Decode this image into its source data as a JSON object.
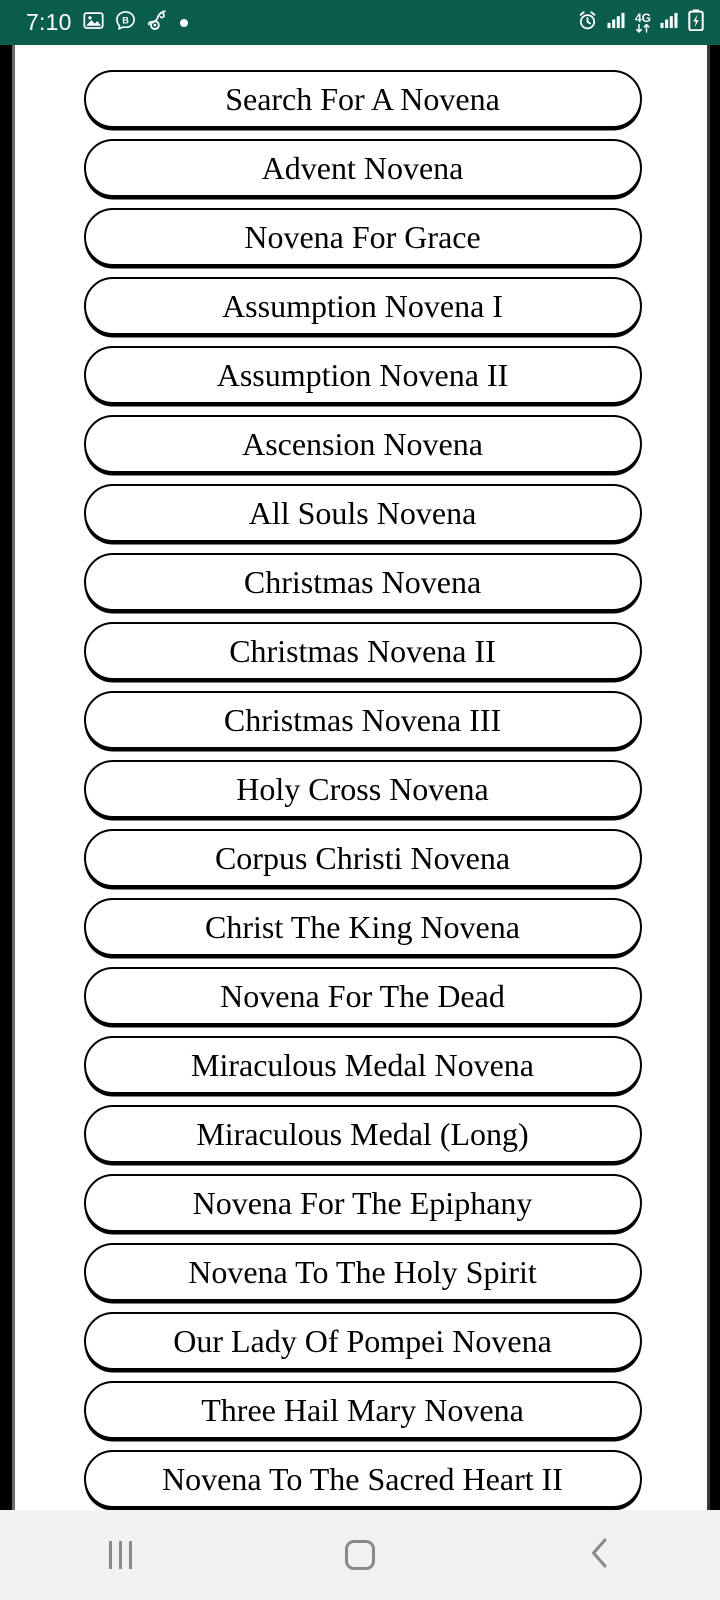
{
  "statusbar": {
    "time": "7:10",
    "network_label": "4G",
    "left_icons": [
      "gallery-icon",
      "messenger-b-icon",
      "uc-browser-squirrel-icon",
      "dot-indicator-icon"
    ],
    "right_icons": [
      "alarm-icon",
      "signal-bars-icon",
      "mobile-data-4g-icon",
      "signal-bars-2-icon",
      "battery-charging-icon"
    ],
    "background_color": "#0a5c4d",
    "foreground_color": "#ffffff"
  },
  "main": {
    "buttons": [
      {
        "label": "Search For A Novena"
      },
      {
        "label": "Advent Novena"
      },
      {
        "label": "Novena For Grace"
      },
      {
        "label": "Assumption Novena I"
      },
      {
        "label": "Assumption Novena II"
      },
      {
        "label": "Ascension Novena"
      },
      {
        "label": "All Souls Novena"
      },
      {
        "label": "Christmas Novena"
      },
      {
        "label": "Christmas Novena II"
      },
      {
        "label": "Christmas Novena III"
      },
      {
        "label": "Holy Cross Novena"
      },
      {
        "label": "Corpus Christi Novena"
      },
      {
        "label": "Christ The King Novena"
      },
      {
        "label": "Novena For The Dead"
      },
      {
        "label": "Miraculous Medal Novena"
      },
      {
        "label": "Miraculous Medal (Long)"
      },
      {
        "label": "Novena For The Epiphany"
      },
      {
        "label": "Novena To The Holy Spirit"
      },
      {
        "label": "Our Lady Of Pompei Novena"
      },
      {
        "label": "Three Hail Mary Novena"
      },
      {
        "label": "Novena To The Sacred Heart II"
      }
    ],
    "button_border_color": "#000000",
    "button_text_color": "#000000",
    "background_color": "#ffffff"
  },
  "navbar": {
    "background_color": "#f1f1f1",
    "icon_color": "#8a8a8a",
    "items": [
      {
        "name": "recents-icon"
      },
      {
        "name": "home-icon"
      },
      {
        "name": "back-icon"
      }
    ]
  }
}
